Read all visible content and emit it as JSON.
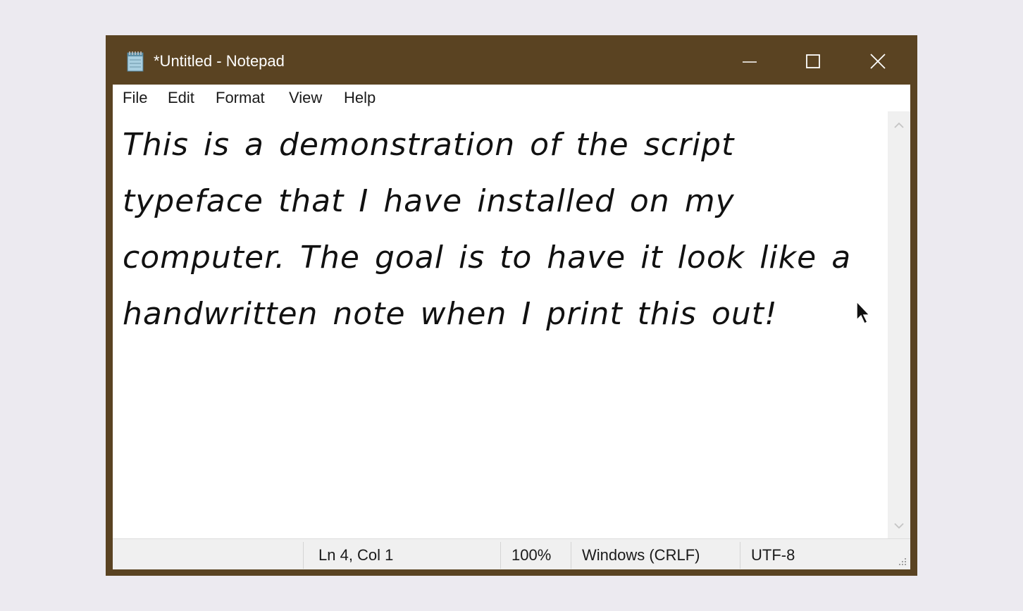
{
  "window": {
    "title": "*Untitled - Notepad",
    "frame_color": "#5a4322"
  },
  "menu": {
    "items": [
      {
        "label": "File"
      },
      {
        "label": "Edit"
      },
      {
        "label": "Format"
      },
      {
        "label": "View"
      },
      {
        "label": "Help"
      }
    ]
  },
  "editor": {
    "content": "This is a demonstration of the script\ntypeface that I have installed on my\ncomputer. The goal is to have it look like a\nhandwritten note when I print this out!"
  },
  "status": {
    "position": "Ln 4, Col 1",
    "zoom": "100%",
    "line_endings": "Windows (CRLF)",
    "encoding": "UTF-8"
  },
  "icons": {
    "app": "notepad-icon",
    "minimize": "minimize-icon",
    "maximize": "maximize-icon",
    "close": "close-icon",
    "scroll_up": "chevron-up-icon",
    "scroll_down": "chevron-down-icon",
    "cursor": "mouse-pointer-icon",
    "grip": "resize-grip-icon"
  }
}
